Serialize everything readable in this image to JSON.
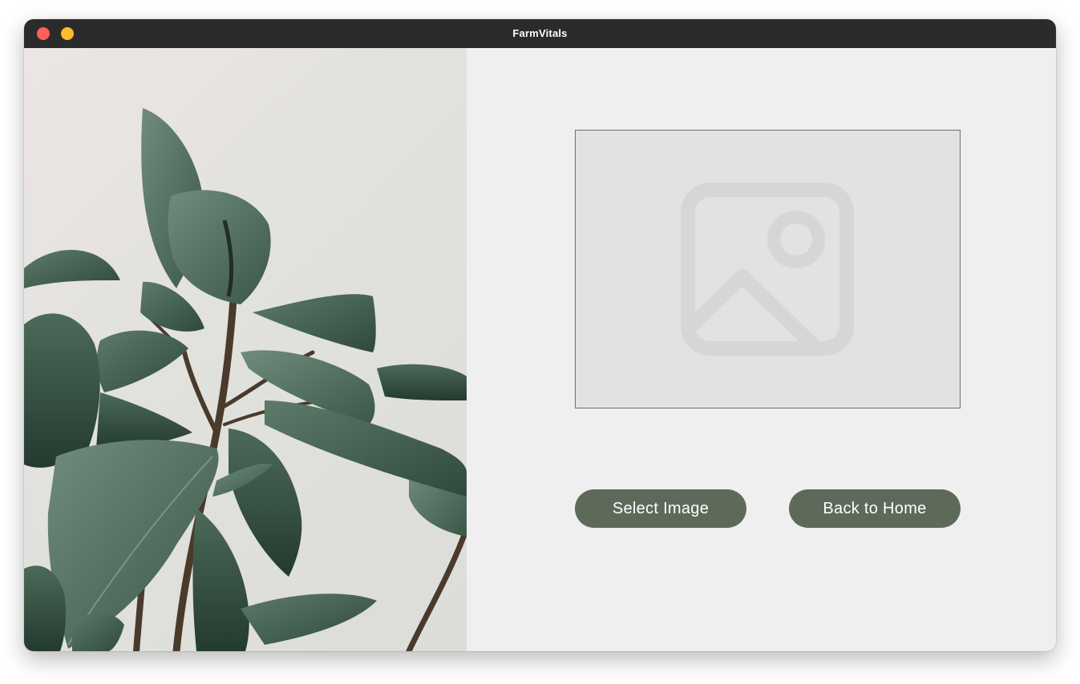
{
  "window": {
    "title": "FarmVitals"
  },
  "main": {
    "select_image_label": "Select Image",
    "back_home_label": "Back to Home",
    "preview_icon": "image-placeholder-icon",
    "illustration": "rubber-plant-photo"
  },
  "colors": {
    "titlebar": "#2b2b2b",
    "button_bg": "#5d6a5a",
    "panel_bg": "#efefef",
    "preview_bg": "#e2e2e2"
  }
}
